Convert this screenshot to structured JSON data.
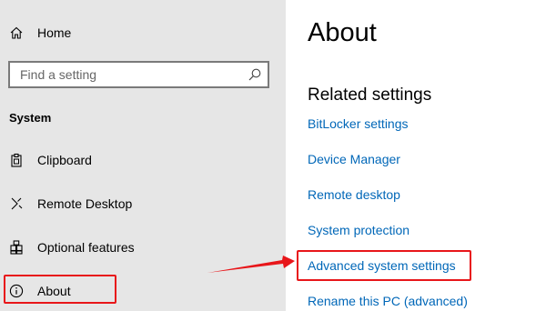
{
  "sidebar": {
    "home_label": "Home",
    "search": {
      "placeholder": "Find a setting",
      "icon": "search-icon"
    },
    "section_heading": "System",
    "items": [
      {
        "label": "Clipboard",
        "icon": "clipboard-icon"
      },
      {
        "label": "Remote Desktop",
        "icon": "remote-desktop-icon"
      },
      {
        "label": "Optional features",
        "icon": "optional-features-icon"
      },
      {
        "label": "About",
        "icon": "info-icon"
      }
    ]
  },
  "main": {
    "title": "About",
    "related_heading": "Related settings",
    "links": [
      "BitLocker settings",
      "Device Manager",
      "Remote desktop",
      "System protection",
      "Advanced system settings",
      "Rename this PC (advanced)"
    ]
  },
  "colors": {
    "sidebar_bg": "#e6e6e6",
    "link": "#0067b8",
    "annotation": "#e8161a"
  }
}
